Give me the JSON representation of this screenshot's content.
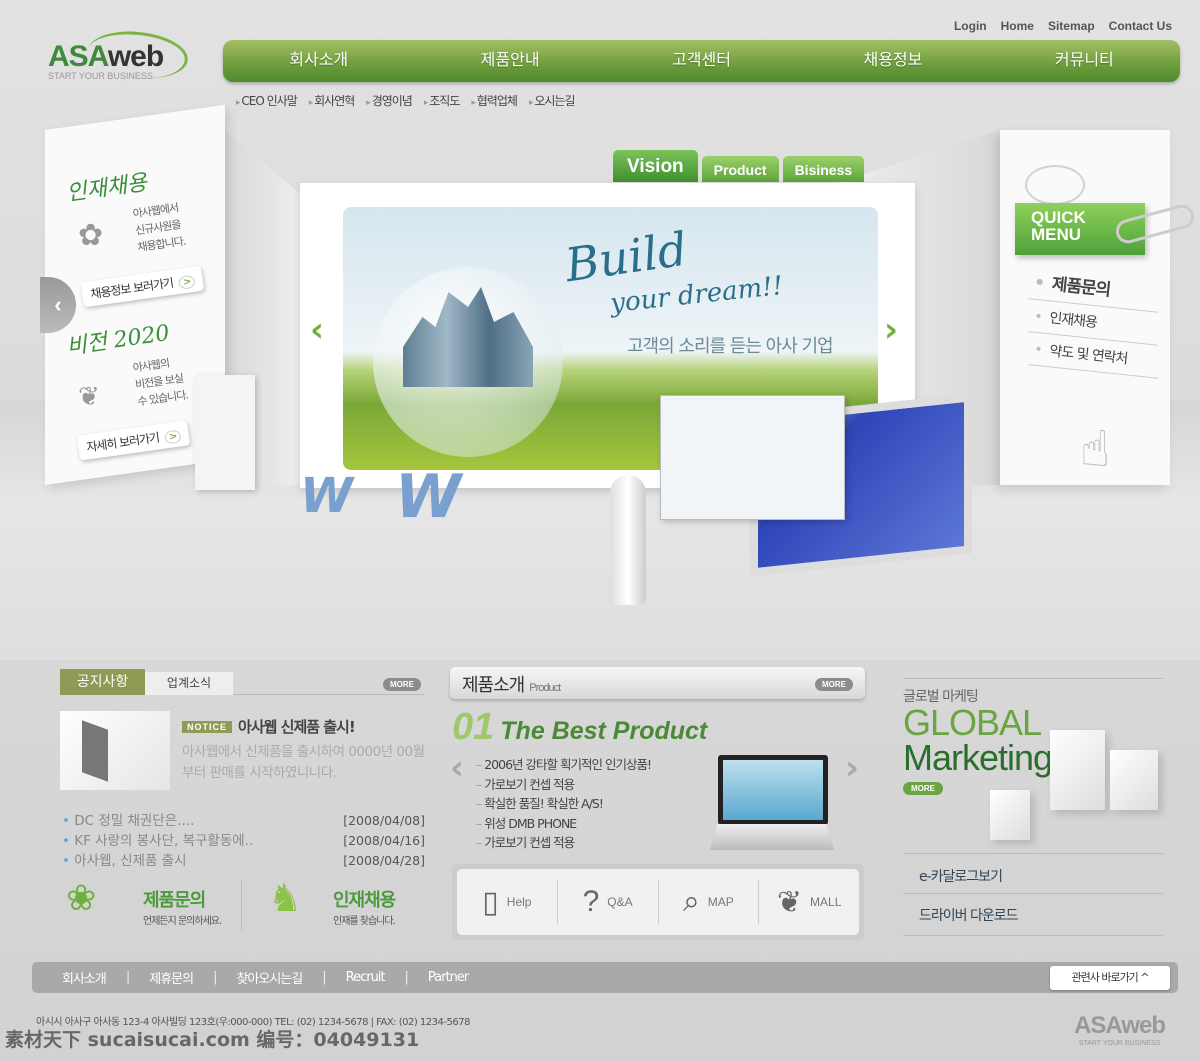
{
  "logo": {
    "name_a": "ASA",
    "name_b": "web",
    "tagline": "START YOUR BUSINESS"
  },
  "top_links": [
    "Login",
    "Home",
    "Sitemap",
    "Contact Us"
  ],
  "nav": [
    "회사소개",
    "제품안내",
    "고객센터",
    "채용정보",
    "커뮤니티"
  ],
  "subnav": [
    "CEO 인사말",
    "회사연혁",
    "경영이념",
    "조직도",
    "협력업체",
    "오시는길"
  ],
  "hero": {
    "tabs": [
      "Vision",
      "Product",
      "Bisiness"
    ],
    "headline_1": "Build",
    "headline_2": "your dream!!",
    "slogan": "고객의 소리를 듣는 아사 기업",
    "left_panel": {
      "recruit_title": "인재채용",
      "recruit_text": [
        "아사웹에서",
        "신규사원을",
        "채용합니다."
      ],
      "recruit_button": "채용정보 보러가기",
      "vision_title": "비전 2020",
      "vision_text": [
        "아사웹의",
        "비전을 보실",
        "수 있습니다."
      ],
      "vision_button": "자세히 보러가기"
    },
    "quick_menu": {
      "title_1": "QUICK",
      "title_2": "MENU",
      "items": [
        "제품문의",
        "인재채용",
        "약도 및 연락처"
      ]
    },
    "accent": "#6cb23c"
  },
  "notice": {
    "tabs": [
      "공지사항",
      "업계소식"
    ],
    "more": "MORE",
    "badge": "NOTICE",
    "title": "아사웹 신제품 출시!",
    "body": "아사웹에서 신제품을 출시하여 0000년 00월 부터 판매를 시작하였니니다.",
    "items": [
      {
        "text": "DC 정밀 채권단은....",
        "date": "[2008/04/08]"
      },
      {
        "text": "KF 사랑의 봉사단, 복구활동에..",
        "date": "[2008/04/16]"
      },
      {
        "text": "아사웹, 신제품 출시",
        "date": "[2008/04/28]"
      }
    ],
    "cta": [
      {
        "title": "제품문의",
        "sub": "언제든지 문의하세요."
      },
      {
        "title": "인재채용",
        "sub": "인재를 찾습니다."
      }
    ]
  },
  "product": {
    "title": "제품소개",
    "subtitle": "Product",
    "more": "MORE",
    "number": "01",
    "headline": "The Best Product",
    "features": [
      "2006년 강타할 획기적인 인기상품!",
      "가로보기 컨셉 적용",
      "확실한 품질! 확실한 A/S!",
      "위성 DMB PHONE",
      "가로보기 컨셉 적용"
    ],
    "icons": [
      {
        "label": "Help",
        "icon": "phone-icon"
      },
      {
        "label": "Q&A",
        "icon": "question-icon"
      },
      {
        "label": "MAP",
        "icon": "map-search-icon"
      },
      {
        "label": "MALL",
        "icon": "hands-sprout-icon"
      }
    ]
  },
  "global": {
    "kicker": "글로벌 마케팅",
    "title_1": "GLOBAL",
    "title_2": "Marketing",
    "more": "MORE",
    "links": [
      "e-카달로그보기",
      "드라이버 다운로드"
    ]
  },
  "footer": {
    "links": [
      "회사소개",
      "제휴문의",
      "찾아오시는길",
      "Recruit",
      "Partner"
    ],
    "related": "관련사 바로가기 ^",
    "address": "아시시 아사구 아사동 123-4 아사빌딩 123호(우:000-000) TEL: (02) 1234-5678 | FAX: (02) 1234-5678",
    "watermark": "素材天下 sucaisucai.com 编号：04049131"
  }
}
